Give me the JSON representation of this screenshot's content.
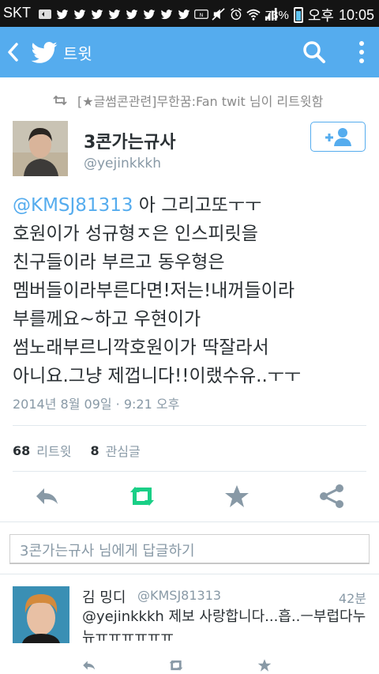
{
  "status_bar": {
    "carrier": "SKT",
    "battery_percent": "73%",
    "ampm": "오후",
    "time": "10:05",
    "battery_level": 0.73
  },
  "app_bar": {
    "title": "트윗",
    "bg_color": "#55acee"
  },
  "retweet_banner": {
    "text": "[★글썸콘관련]무한꿈:Fan twit 님이 리트윗함"
  },
  "tweet": {
    "display_name": "3콘가는규사",
    "handle": "@yejinkkkh",
    "mention": "@KMSJ81313",
    "line1_rest": " 아 그리고또ㅜㅜ",
    "lines": [
      "호원이가 성규형ㅈ은 인스피릿을",
      "친구들이라 부르고 동우형은",
      "멤버들이라부른다면!저는!내꺼들이라",
      "부를께요~하고 우현이가",
      "썸노래부르니깍호원이가 딱잘라서",
      "아니요.그냥 제껍니다!!이랬수유..ㅜㅜ"
    ],
    "date": "2014년 8월 09일 · 9:21 오후",
    "retweet_count": "68",
    "retweet_label": "리트윗",
    "favorite_count": "8",
    "favorite_label": "관심글"
  },
  "reply_box": {
    "placeholder": "3콘가는규사 님에게 답글하기"
  },
  "reply": {
    "name": "김 밍디",
    "handle": "@KMSJ81313",
    "time": "42분",
    "text": "@yejinkkkh 제보 사랑합니다...흡..ㅡ부럽다누뉴ㅠㅠㅠㅠㅠㅠ"
  },
  "colors": {
    "accent": "#55acee",
    "retweet_green": "#19cf86"
  },
  "icons": [
    "back-icon",
    "twitter-bird-icon",
    "search-icon",
    "overflow-menu-icon",
    "retweet-icon",
    "follow-icon",
    "reply-icon",
    "star-icon",
    "share-icon"
  ]
}
